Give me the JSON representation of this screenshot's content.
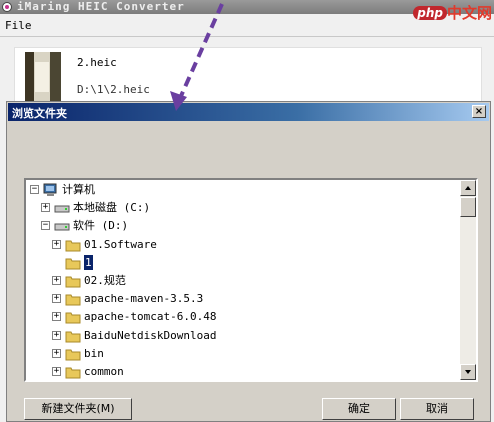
{
  "app": {
    "title": "iMaring HEIC Converter",
    "menu": [
      "File"
    ],
    "file": {
      "name": "2.heic",
      "path": "D:\\1\\2.heic"
    }
  },
  "watermark": {
    "badge": "php",
    "site": "中文网"
  },
  "dialog": {
    "title": "浏览文件夹",
    "close_label": "×",
    "tree": [
      {
        "label": "计算机",
        "expander": "minus",
        "icon": "computer-icon",
        "depth": 0
      },
      {
        "label": "本地磁盘 (C:)",
        "expander": "plus",
        "icon": "drive-icon",
        "depth": 1
      },
      {
        "label": "软件 (D:)",
        "expander": "minus",
        "icon": "drive-icon",
        "depth": 1
      },
      {
        "label": "01.Software",
        "expander": "plus",
        "icon": "folder-icon",
        "depth": 2
      },
      {
        "label": "1",
        "expander": "none",
        "icon": "folder-icon",
        "depth": 2,
        "selected": true
      },
      {
        "label": "02.规范",
        "expander": "plus",
        "icon": "folder-icon",
        "depth": 2
      },
      {
        "label": "apache-maven-3.5.3",
        "expander": "plus",
        "icon": "folder-icon",
        "depth": 2
      },
      {
        "label": "apache-tomcat-6.0.48",
        "expander": "plus",
        "icon": "folder-icon",
        "depth": 2
      },
      {
        "label": "BaiduNetdiskDownload",
        "expander": "plus",
        "icon": "folder-icon",
        "depth": 2
      },
      {
        "label": "bin",
        "expander": "plus",
        "icon": "folder-icon",
        "depth": 2
      },
      {
        "label": "common",
        "expander": "plus",
        "icon": "folder-icon",
        "depth": 2
      }
    ],
    "buttons": {
      "new_folder": "新建文件夹(M)",
      "ok": "确定",
      "cancel": "取消"
    }
  },
  "colors": {
    "dialog_title_start": "#0a246a",
    "dialog_title_end": "#a6caf0",
    "arrow": "#6a3fa0",
    "selection": "#0a246a"
  }
}
